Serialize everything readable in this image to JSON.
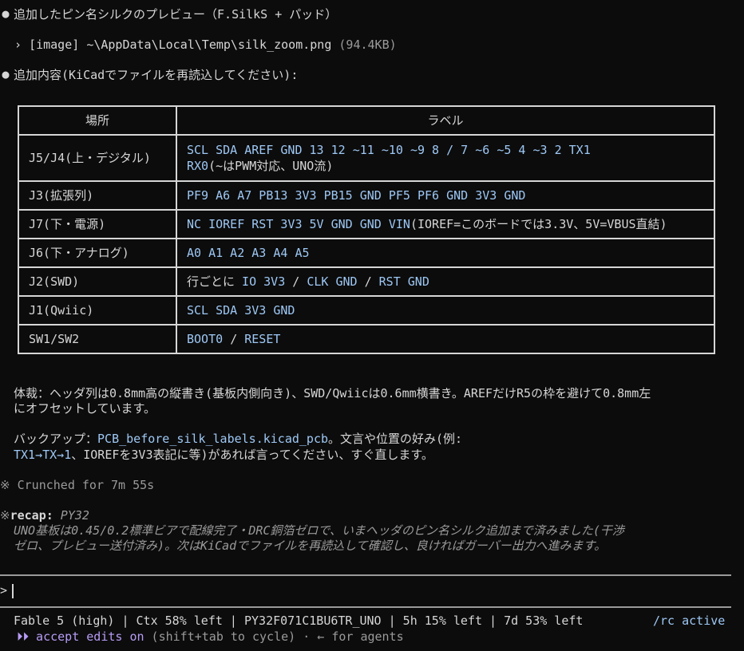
{
  "messages": {
    "m1_text": "追加したピン名シルクのプレビュー（F.SilkS + パッド）",
    "image_tag": "[image]",
    "image_path": "~\\AppData\\Local\\Temp\\silk_zoom.png",
    "image_size": "(94.4KB)",
    "m2_text": "追加内容(KiCadでファイルを再読込してください):"
  },
  "table": {
    "headers": [
      "場所",
      "ラベル"
    ],
    "rows": [
      {
        "loc": "J5/J4(上・デジタル)",
        "label1": "SCL SDA AREF GND 13 12 ~11 ~10 ~9 8 / 7 ~6 ~5 4 ~3 2 TX1",
        "label2a": "RX0",
        "label2b": "(~はPWM対応、UNO流)"
      },
      {
        "loc": "J3(拡張列)",
        "label": "PF9 A6 A7 PB13 3V3 PB15 GND PF5 PF6 GND 3V3 GND"
      },
      {
        "loc": "J7(下・電源)",
        "label_code": "NC IOREF RST 3V3 5V GND GND VIN",
        "label_rest": "(IOREF=このボードでは3.3V、5V=VBUS直結)"
      },
      {
        "loc": "J6(下・アナログ)",
        "label": "A0 A1 A2 A3 A4 A5"
      },
      {
        "loc": "J2(SWD)",
        "prefix": "行ごとに",
        "p1": "IO 3V3",
        "sep1": "/",
        "p2": "CLK GND",
        "sep2": "/",
        "p3": "RST GND"
      },
      {
        "loc": "J1(Qwiic)",
        "label": "SCL SDA 3V3 GND"
      },
      {
        "loc": "SW1/SW2",
        "p1": "BOOT0",
        "sep": "/",
        "p2": "RESET"
      }
    ]
  },
  "notes": {
    "style_line1": "体裁：ヘッダ列は0.8mm高の縦書き(基板内側向き)、SWD/Qwiicは0.6mm横書き。AREFだけR5の枠を避けて0.8mm左",
    "style_line2": "にオフセットしています。",
    "backup_prefix": "バックアップ：",
    "backup_file": "PCB_before_silk_labels.kicad_pcb",
    "backup_suffix": "。文言や位置の好み(例:",
    "backup_line2_code": "TX1→TX→1",
    "backup_line2_rest": "、IOREFを3V3表記に等)があれば言ってください、すぐ直します。"
  },
  "crunched": "Crunched for 7m 55s",
  "recap": {
    "label": "recap:",
    "title": "PY32",
    "line1": "UNO基板は0.45/0.2標準ビアで配線完了・DRC銅箔ゼロで、いまヘッダのピン名シルク追加まで済みました(干渉",
    "line2": "ゼロ、プレビュー送付済み)。次はKiCadでファイルを再読込して確認し、良ければガーバー出力へ進みます。"
  },
  "prompt": {
    "symbol": ">"
  },
  "status": {
    "left": "Fable 5 (high) | Ctx 58% left | PY32F071C1BU6TR_UNO | 5h 15% left | 7d 53% left",
    "right": "/rc active",
    "mode_icon": "⏵⏵",
    "mode": "accept edits on",
    "mode_hint": "(shift+tab to cycle) · ← for agents"
  },
  "colors": {
    "accent_blue": "#9ec8f5",
    "accent_purple": "#b69cf5",
    "bg": "#0c0c0c"
  }
}
